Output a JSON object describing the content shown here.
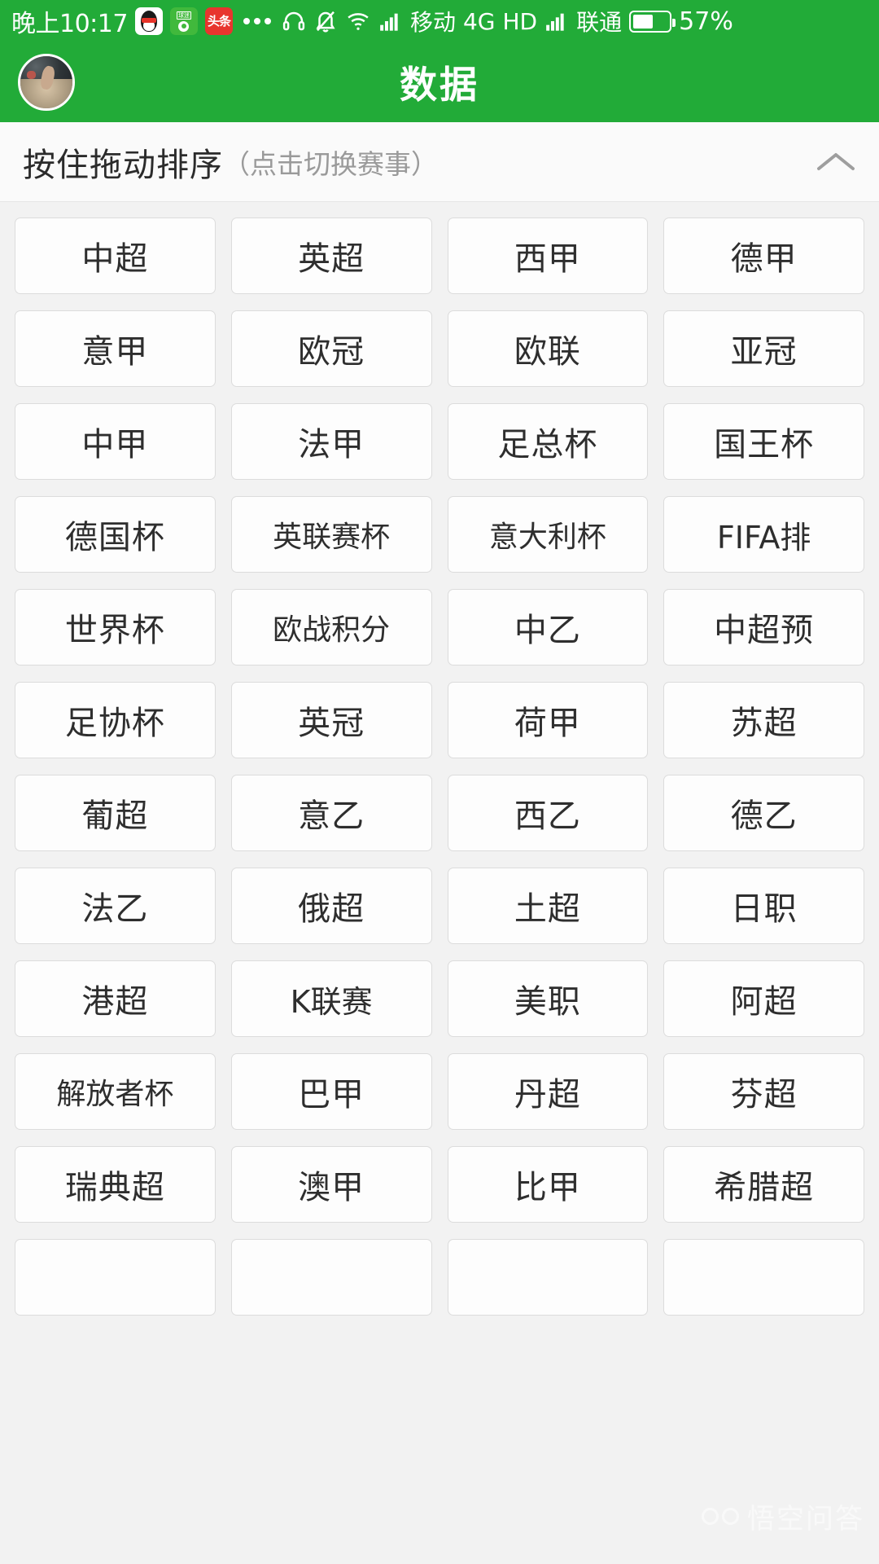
{
  "statusbar": {
    "time": "晚上10:17",
    "app_icons": [
      {
        "name": "qq-icon",
        "label": ""
      },
      {
        "name": "sports-app-icon",
        "label": "球迷"
      },
      {
        "name": "toutiao-icon",
        "label": "头条"
      }
    ],
    "overflow_dots": "...",
    "icons": [
      "headset-icon",
      "bell-muted-icon",
      "wifi-icon",
      "signal-icon"
    ],
    "carrier_1": "移动",
    "network_type": "4G",
    "hd_label": "HD",
    "carrier_2": "联通",
    "battery_percent": "57%",
    "battery_level": 57
  },
  "header": {
    "title": "数据",
    "avatar_name": "user-avatar",
    "bg_color": "#22ab38"
  },
  "subheader": {
    "main_text": "按住拖动排序",
    "hint_text": "（点击切换赛事）",
    "collapse_icon": "chevron-up-icon"
  },
  "grid": {
    "columns": 4,
    "items": [
      "中超",
      "英超",
      "西甲",
      "德甲",
      "意甲",
      "欧冠",
      "欧联",
      "亚冠",
      "中甲",
      "法甲",
      "足总杯",
      "国王杯",
      "德国杯",
      "英联赛杯",
      "意大利杯",
      "FIFA排",
      "世界杯",
      "欧战积分",
      "中乙",
      "中超预",
      "足协杯",
      "英冠",
      "荷甲",
      "苏超",
      "葡超",
      "意乙",
      "西乙",
      "德乙",
      "法乙",
      "俄超",
      "土超",
      "日职",
      "港超",
      "K联赛",
      "美职",
      "阿超",
      "解放者杯",
      "巴甲",
      "丹超",
      "芬超",
      "瑞典超",
      "澳甲",
      "比甲",
      "希腊超",
      "",
      "",
      "",
      ""
    ]
  },
  "watermark": {
    "text": "悟空问答",
    "logo_name": "wukong-logo"
  }
}
